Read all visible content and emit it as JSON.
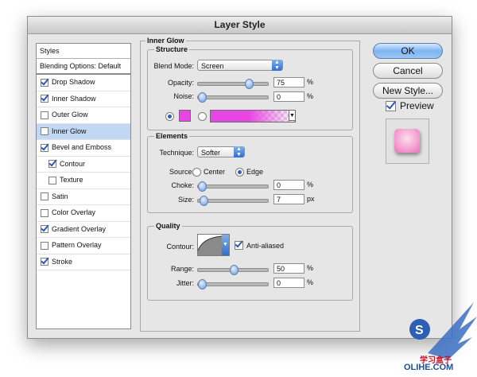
{
  "window": {
    "title": "Layer Style"
  },
  "styles_panel": {
    "header": "Styles",
    "blending_options": "Blending Options: Default",
    "items": [
      {
        "label": "Drop Shadow",
        "checked": true,
        "sub": false,
        "selected": false
      },
      {
        "label": "Inner Shadow",
        "checked": true,
        "sub": false,
        "selected": false
      },
      {
        "label": "Outer Glow",
        "checked": false,
        "sub": false,
        "selected": false
      },
      {
        "label": "Inner Glow",
        "checked": false,
        "sub": false,
        "selected": true
      },
      {
        "label": "Bevel and Emboss",
        "checked": true,
        "sub": false,
        "selected": false
      },
      {
        "label": "Contour",
        "checked": true,
        "sub": true,
        "selected": false
      },
      {
        "label": "Texture",
        "checked": false,
        "sub": true,
        "selected": false
      },
      {
        "label": "Satin",
        "checked": false,
        "sub": false,
        "selected": false
      },
      {
        "label": "Color Overlay",
        "checked": false,
        "sub": false,
        "selected": false
      },
      {
        "label": "Gradient Overlay",
        "checked": true,
        "sub": false,
        "selected": false
      },
      {
        "label": "Pattern Overlay",
        "checked": false,
        "sub": false,
        "selected": false
      },
      {
        "label": "Stroke",
        "checked": true,
        "sub": false,
        "selected": false
      }
    ]
  },
  "inner_glow": {
    "title": "Inner Glow",
    "structure": {
      "title": "Structure",
      "blend_mode_label": "Blend Mode:",
      "blend_mode_value": "Screen",
      "opacity_label": "Opacity:",
      "opacity_value": "75",
      "opacity_unit": "%",
      "opacity_level": 0.75,
      "noise_label": "Noise:",
      "noise_value": "0",
      "noise_unit": "%",
      "noise_level": 0.0,
      "glow_color": "#e846e3",
      "color_mode": "solid"
    },
    "elements": {
      "title": "Elements",
      "technique_label": "Technique:",
      "technique_value": "Softer",
      "source_label": "Source:",
      "source_center": "Center",
      "source_edge": "Edge",
      "source_selected": "Edge",
      "choke_label": "Choke:",
      "choke_value": "0",
      "choke_unit": "%",
      "choke_level": 0.0,
      "size_label": "Size:",
      "size_value": "7",
      "size_unit": "px",
      "size_level": 0.03
    },
    "quality": {
      "title": "Quality",
      "contour_label": "Contour:",
      "anti_aliased_label": "Anti-aliased",
      "anti_aliased": true,
      "range_label": "Range:",
      "range_value": "50",
      "range_unit": "%",
      "range_level": 0.5,
      "jitter_label": "Jitter:",
      "jitter_value": "0",
      "jitter_unit": "%",
      "jitter_level": 0.0
    }
  },
  "buttons": {
    "ok": "OK",
    "cancel": "Cancel",
    "new_style": "New Style...",
    "preview": "Preview",
    "preview_checked": true
  },
  "watermark": {
    "line1": "学习盒子",
    "line2": "OLIHE.COM"
  },
  "colors": {
    "accent": "#2f6fd0",
    "selection": "#c0d8f4",
    "preview_pink": "#f59fd0"
  }
}
